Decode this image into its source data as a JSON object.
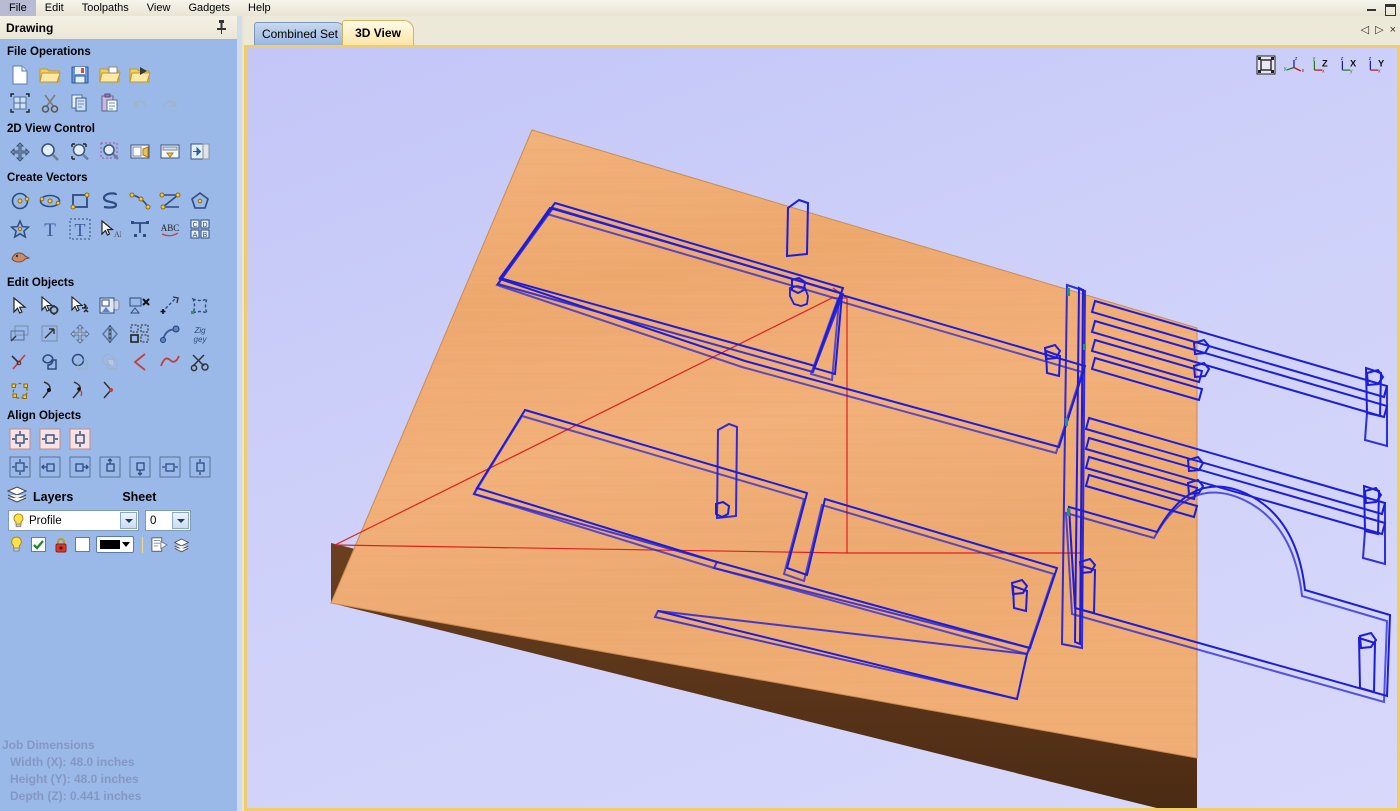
{
  "app": {
    "menu": [
      "File",
      "Edit",
      "Toolpaths",
      "View",
      "Gadgets",
      "Help"
    ],
    "window_controls": [
      "minimize-icon",
      "restore-icon"
    ]
  },
  "drawing_panel": {
    "header": "Drawing",
    "pin_icon": "pin-icon",
    "sections": [
      {
        "title": "File Operations",
        "rows": [
          [
            "new-file-icon",
            "open-file-icon",
            "save-file-icon",
            "open-recent-icon",
            "import-vectors-icon"
          ],
          [
            "job-setup-icon",
            "cut-icon",
            "copy-icon",
            "paste-icon",
            "undo-icon",
            "redo-icon"
          ]
        ]
      },
      {
        "title": "2D View Control",
        "rows": [
          [
            "pan-view-icon",
            "zoom-in-icon",
            "zoom-extents-icon",
            "zoom-selection-icon",
            "zoom-to-drawing-icon",
            "zoom-to-sheet-icon",
            "toggle-panel-icon"
          ]
        ]
      },
      {
        "title": "Create Vectors",
        "rows": [
          [
            "circle-icon",
            "ellipse-icon",
            "rectangle-icon",
            "polyline-icon",
            "arc-icon",
            "polyline-nodes-icon",
            "polygon-icon"
          ],
          [
            "star-icon",
            "draw-text-icon",
            "text-box-icon",
            "text-selection-icon",
            "text-on-curve-icon",
            "text-arc-icon",
            "text-grid-icon"
          ],
          [
            "trace-bitmap-icon"
          ]
        ]
      },
      {
        "title": "Edit Objects",
        "rows": [
          [
            "select-icon",
            "node-edit-icon",
            "move-select-icon",
            "group-vectors-icon",
            "ungroup-vectors-icon",
            "join-vectors-icon",
            "deform-icon"
          ],
          [
            "offset-icon",
            "scale-icon",
            "move-icon",
            "mirror-icon",
            "array-copy-icon",
            "fit-curve-icon",
            "nest-icon"
          ],
          [
            "measure-icon",
            "weld-icon",
            "subtract-icon",
            "intersect-icon",
            "fillet-icon",
            "curve-fit-icon",
            "trim-icon"
          ],
          [
            "node-editing-icon",
            "smooth-node-icon",
            "curve-node-icon",
            "insert-point-icon"
          ]
        ]
      },
      {
        "title": "Align Objects",
        "rows": [
          [
            "center-in-job-icon",
            "center-horizontally-icon",
            "center-vertically-icon"
          ],
          [
            "align-center-icon",
            "align-left-icon",
            "align-right-icon",
            "align-top-icon",
            "align-bottom-icon",
            "align-h-center-icon",
            "align-v-center-icon"
          ]
        ]
      }
    ],
    "layers": {
      "layers_icon": "layers-stack-icon",
      "layers_label": "Layers",
      "sheet_label": "Sheet",
      "layer_value": "Profile",
      "layer_bulb_icon": "lightbulb-icon",
      "sheet_value": "0",
      "toggles": [
        "lightbulb-visible-icon",
        "checkbox-checked-icon",
        "padlock-locked-icon",
        "white-color-swatch",
        "layer-color-dropdown"
      ],
      "actions": [
        "layer-properties-icon",
        "layer-manager-icon"
      ]
    },
    "job_dimensions": {
      "title": "Job Dimensions",
      "width": "Width  (X): 48.0 inches",
      "height": "Height (Y): 48.0 inches",
      "depth": "Depth  (Z): 0.441 inches"
    }
  },
  "tabs": {
    "inactive": "Combined Set",
    "active": "3D View",
    "nav": [
      "◁",
      "▷",
      "×"
    ]
  },
  "viewport": {
    "tools": [
      "zoom-extents-3d-icon",
      "isometric-view-icon",
      "top-z-view-icon",
      "front-x-view-icon",
      "right-y-view-icon"
    ],
    "axis_labels": {
      "z": "Z",
      "x": "X",
      "y": "Y"
    },
    "material_color": "#f0ab70",
    "edge_color": "#5a3418",
    "toolpath_color": "#1c1cdc",
    "rapid_color": "#e02020",
    "background_color": "#cdd0f9"
  }
}
